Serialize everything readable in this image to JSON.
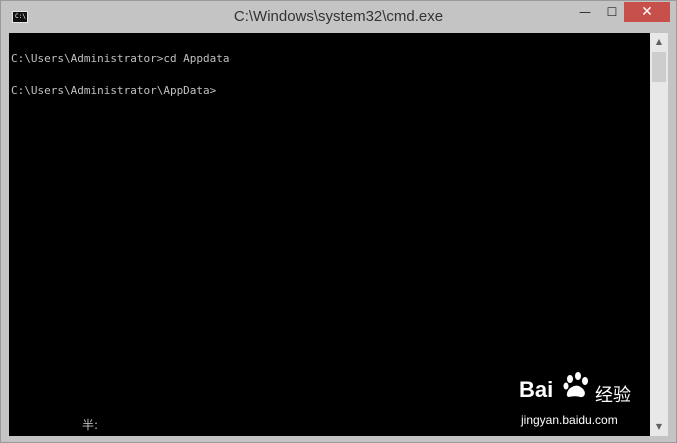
{
  "window": {
    "title": "C:\\Windows\\system32\\cmd.exe",
    "icon_text": "C:\\",
    "minimize_glyph": "—",
    "maximize_glyph": "☐",
    "close_glyph": "✕"
  },
  "console": {
    "lines": [
      "C:\\Users\\Administrator>cd Appdata",
      "C:\\Users\\Administrator\\AppData>"
    ],
    "ime_status": "半:",
    "text_color": "#c0c0c0",
    "background": "#000000"
  },
  "scrollbar": {
    "up_glyph": "▲",
    "down_glyph": "▼"
  },
  "watermark": {
    "brand": "Bai",
    "text": "经验",
    "url": "jingyan.baidu.com"
  }
}
